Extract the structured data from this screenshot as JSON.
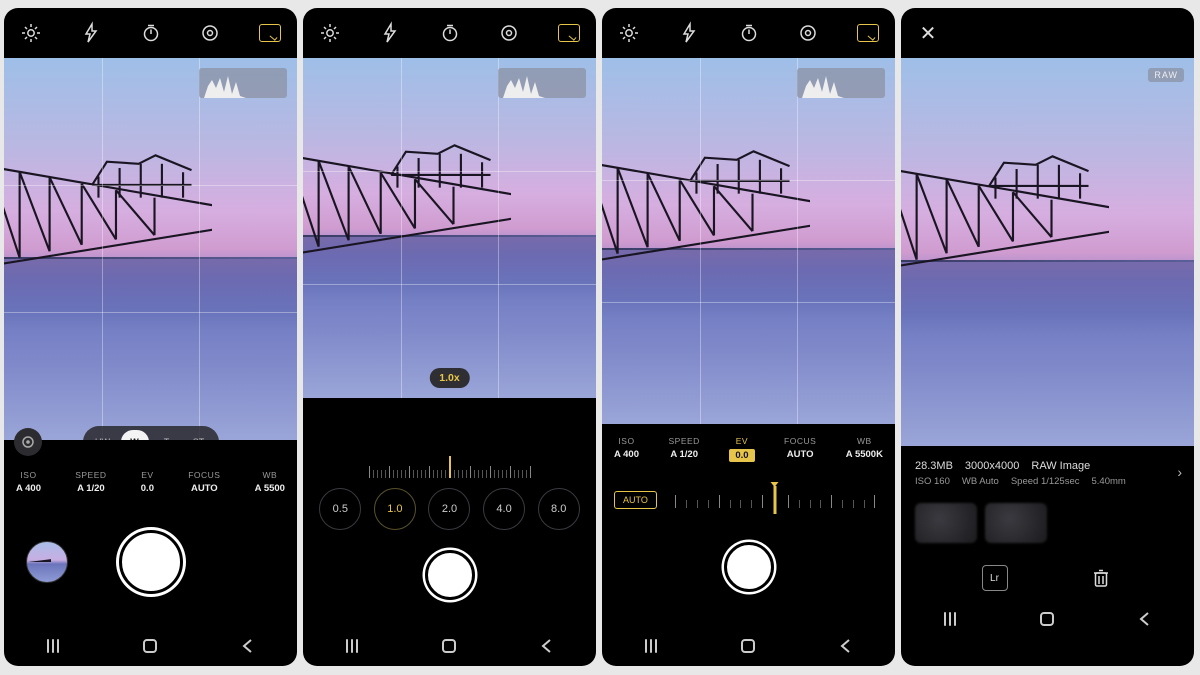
{
  "colors": {
    "accent": "#e7c54a"
  },
  "icons": {
    "settings": "gear-icon",
    "flash": "flash-icon",
    "timer": "timer-icon",
    "metering": "metering-icon",
    "aspect": "aspect-ratio-icon",
    "close": "close-icon"
  },
  "panel1": {
    "params": {
      "iso": {
        "label": "ISO",
        "value": "A 400"
      },
      "speed": {
        "label": "SPEED",
        "value": "A 1/20"
      },
      "ev": {
        "label": "EV",
        "value": "0.0"
      },
      "focus": {
        "label": "FOCUS",
        "value": "AUTO"
      },
      "wb": {
        "label": "WB",
        "value": "A 5500"
      }
    },
    "lenses": {
      "uw": "UW",
      "w": "W",
      "t": "T",
      "st": "ST"
    }
  },
  "panel2": {
    "zoom_selected": "1.0x",
    "zoom_options": {
      "z05": "0.5",
      "z10": "1.0",
      "z20": "2.0",
      "z40": "4.0",
      "z80": "8.0"
    }
  },
  "panel3": {
    "params": {
      "iso": {
        "label": "ISO",
        "value": "A 400"
      },
      "speed": {
        "label": "SPEED",
        "value": "A 1/20"
      },
      "ev": {
        "label": "EV",
        "value": "0.0"
      },
      "focus": {
        "label": "FOCUS",
        "value": "AUTO"
      },
      "wb": {
        "label": "WB",
        "value": "A 5500K"
      }
    },
    "auto_label": "AUTO"
  },
  "panel4": {
    "raw_badge": "RAW",
    "meta1": {
      "size": "28.3MB",
      "dims": "3000x4000",
      "type": "RAW Image"
    },
    "meta2": {
      "iso": "ISO 160",
      "wb": "WB Auto",
      "speed": "Speed 1/125sec",
      "focal": "5.40mm"
    },
    "lightroom_label": "Lr"
  }
}
